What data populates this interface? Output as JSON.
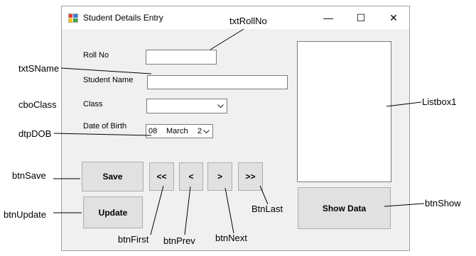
{
  "window": {
    "title": "Student Details Entry",
    "controls": {
      "minimize": "—",
      "maximize": "☐",
      "close": "✕"
    }
  },
  "form": {
    "labels": {
      "roll_no": "Roll No",
      "student_name": "Student Name",
      "class": "Class",
      "dob": "Date of Birth"
    },
    "date_picker": {
      "day": "08",
      "month": "March",
      "year_partial": "2"
    },
    "buttons": {
      "save": "Save",
      "update": "Update",
      "first": "<<",
      "prev": "<",
      "next": ">",
      "last": ">>",
      "show": "Show Data"
    }
  },
  "annotations": {
    "txtRollNo": "txtRollNo",
    "txtSName": "txtSName",
    "cboClass": "cboClass",
    "dtpDOB": "dtpDOB",
    "btnSave": "btnSave",
    "btnUpdate": "btnUpdate",
    "btnFirst": "btnFirst",
    "btnPrev": "btnPrev",
    "btnNext": "btnNext",
    "BtnLast": "BtnLast",
    "Listbox1": "Listbox1",
    "btnShow": "btnShow"
  }
}
